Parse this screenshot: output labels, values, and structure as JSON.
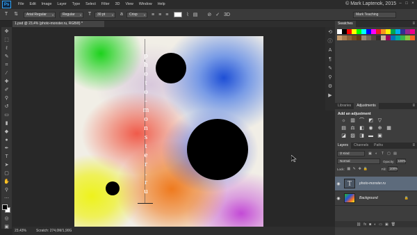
{
  "menubar": {
    "logo": "Ps",
    "items": [
      "File",
      "Edit",
      "Image",
      "Layer",
      "Type",
      "Select",
      "Filter",
      "3D",
      "View",
      "Window",
      "Help"
    ],
    "watermark": "© Mark Laptenok, 2015",
    "window_controls": [
      "–",
      "□",
      "×"
    ]
  },
  "options": {
    "font_family": "Arial Regular",
    "font_style": "Regular",
    "font_size": "30 pt",
    "antialias": "Crisp",
    "text_color": "#ffffff",
    "workspace": "Mark Teaching"
  },
  "document": {
    "tab_title": "1.psd @ 23,4% (photo-monster.ru, RGB/8) *",
    "vertical_text": [
      "p",
      "h",
      "o",
      "t",
      "o",
      "-",
      "m",
      "o",
      "n",
      "s",
      "t",
      "e",
      "r",
      ".",
      "r",
      "u"
    ]
  },
  "status": {
    "zoom": "23,43%",
    "scratch": "Scratch: 274,0M/1,90G"
  },
  "panels": {
    "swatches_tab": "Swatches",
    "swatch_colors": [
      [
        "#ffffff",
        "#000000",
        "#ff0000",
        "#ffff00",
        "#00ff00",
        "#00ffff",
        "#0000ff",
        "#ff00ff",
        "#ed1c24",
        "#f7941d",
        "#fff200",
        "#00a651",
        "#00aeef",
        "#2e3192",
        "#92278f",
        "#ec008c"
      ],
      [
        "#c69c6d",
        "#a67c52",
        "#8c6239",
        "#754c24",
        "#603913",
        "#998675",
        "#736357",
        "#534741",
        "#362f2d",
        "#c7b299",
        "#9e005d",
        "#0072bc",
        "#00a99d",
        "#39b54a",
        "#8dc63f",
        "#f26522"
      ]
    ],
    "adjust_tabs": [
      "Libraries",
      "Adjustments"
    ],
    "adjust_title": "Add an adjustment",
    "layers_tabs": [
      "Layers",
      "Channels",
      "Paths"
    ],
    "kind": "Kind",
    "blend_mode": "Normal",
    "opacity_label": "Opacity:",
    "opacity_value": "100%",
    "lock_label": "Lock:",
    "fill_label": "Fill:",
    "fill_value": "100%",
    "layers": [
      {
        "name": "photo-monster.ru",
        "type": "text",
        "selected": true
      },
      {
        "name": "Background",
        "type": "image",
        "selected": false
      }
    ]
  }
}
